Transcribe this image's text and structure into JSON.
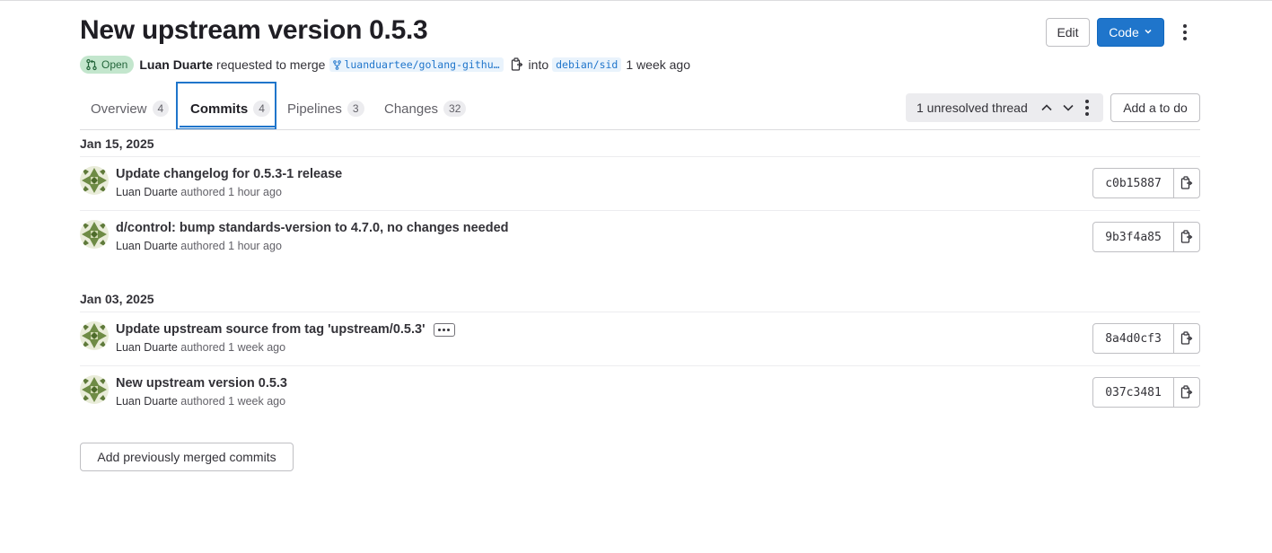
{
  "header": {
    "title": "New upstream version 0.5.3",
    "edit_label": "Edit",
    "code_label": "Code",
    "more_icon": "ellipsis-v-icon"
  },
  "meta": {
    "status": "Open",
    "author": "Luan Duarte",
    "action": "requested to merge",
    "source_branch": "luanduartee/golang-githu…",
    "into": "into",
    "target_branch": "debian/sid",
    "time": "1 week ago"
  },
  "tabs": [
    {
      "label": "Overview",
      "count": "4"
    },
    {
      "label": "Commits",
      "count": "4"
    },
    {
      "label": "Pipelines",
      "count": "3"
    },
    {
      "label": "Changes",
      "count": "32"
    }
  ],
  "threads": {
    "label": "1 unresolved thread"
  },
  "todo_label": "Add a to do",
  "groups": [
    {
      "date": "Jan 15, 2025",
      "commits": [
        {
          "title": "Update changelog for 0.5.3-1 release",
          "author": "Luan Duarte",
          "verb": "authored",
          "time": "1 hour ago",
          "sha": "c0b15887"
        },
        {
          "title": "d/control: bump standards-version to 4.7.0, no changes needed",
          "author": "Luan Duarte",
          "verb": "authored",
          "time": "1 hour ago",
          "sha": "9b3f4a85"
        }
      ]
    },
    {
      "date": "Jan 03, 2025",
      "commits": [
        {
          "title": "Update upstream source from tag 'upstream/0.5.3'",
          "author": "Luan Duarte",
          "verb": "authored",
          "time": "1 week ago",
          "sha": "8a4d0cf3"
        },
        {
          "title": "New upstream version 0.5.3",
          "author": "Luan Duarte",
          "verb": "authored",
          "time": "1 week ago",
          "sha": "037c3481"
        }
      ]
    }
  ],
  "add_merged_label": "Add previously merged commits",
  "colors": {
    "primary": "#1f75cb",
    "open_badge_bg": "#c3e6cd",
    "open_badge_fg": "#24663b"
  }
}
